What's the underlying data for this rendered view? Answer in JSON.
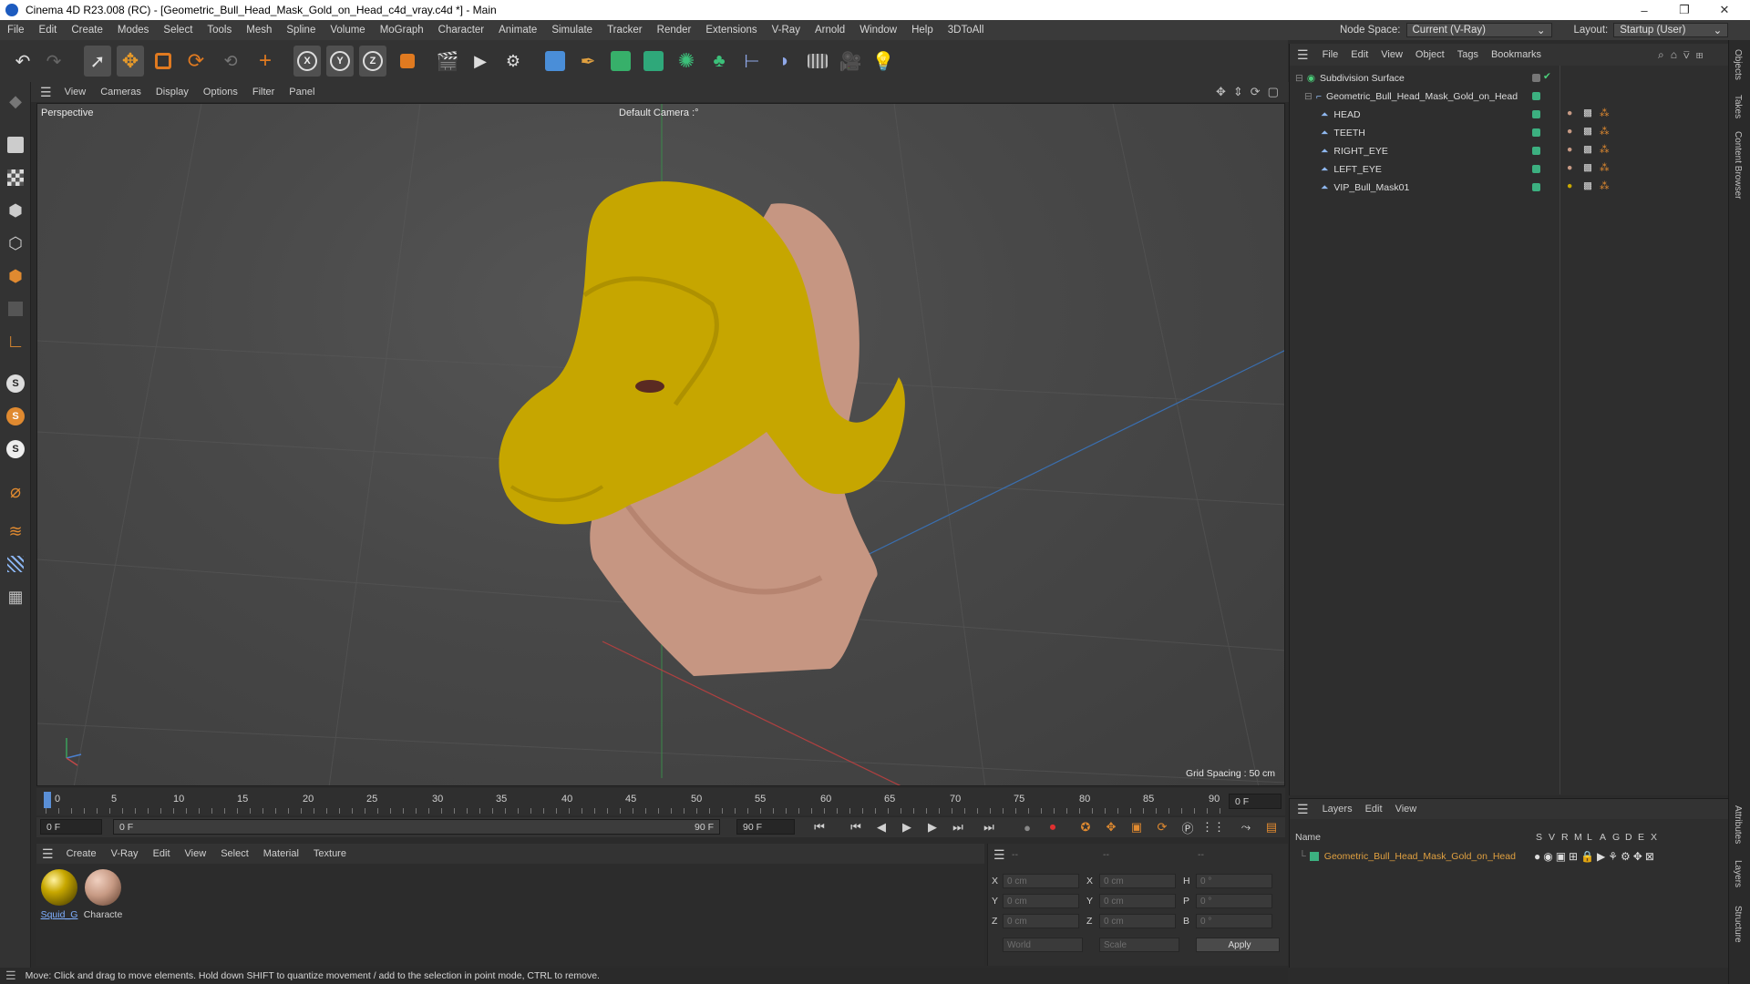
{
  "window": {
    "title": "Cinema 4D R23.008 (RC) - [Geometric_Bull_Head_Mask_Gold_on_Head_c4d_vray.c4d *] - Main",
    "minimize": "–",
    "maximize": "❐",
    "close": "✕"
  },
  "menubar": {
    "items": [
      "File",
      "Edit",
      "Create",
      "Modes",
      "Select",
      "Tools",
      "Mesh",
      "Spline",
      "Volume",
      "MoGraph",
      "Character",
      "Animate",
      "Simulate",
      "Tracker",
      "Render",
      "Extensions",
      "V-Ray",
      "Arnold",
      "Window",
      "Help",
      "3DToAll"
    ],
    "node_space_label": "Node Space:",
    "node_space_value": "Current (V-Ray)",
    "layout_label": "Layout:",
    "layout_value": "Startup (User)"
  },
  "viewport": {
    "menu": [
      "View",
      "Cameras",
      "Display",
      "Options",
      "Filter",
      "Panel"
    ],
    "view_name": "Perspective",
    "camera_name": "Default Camera",
    "grid_spacing": "Grid Spacing : 50 cm"
  },
  "timeline": {
    "ticks": [
      "0",
      "5",
      "10",
      "15",
      "20",
      "25",
      "30",
      "35",
      "40",
      "45",
      "50",
      "55",
      "60",
      "65",
      "70",
      "75",
      "80",
      "85",
      "90"
    ],
    "current_frame": "0 F",
    "start_field": "0 F",
    "range_start": "0 F",
    "range_end": "90 F",
    "end_field": "90 F"
  },
  "material_manager": {
    "menu": [
      "Create",
      "V-Ray",
      "Edit",
      "View",
      "Select",
      "Material",
      "Texture"
    ],
    "materials": [
      {
        "name": "Squid_G",
        "color": "#c8a800"
      },
      {
        "name": "Characte",
        "color": "#c79a84"
      }
    ]
  },
  "coordinates": {
    "header": [
      "--",
      "--",
      "--"
    ],
    "rows": [
      {
        "axis": "X",
        "pos": "0 cm",
        "axis2": "X",
        "size": "0 cm",
        "rot_label": "H",
        "rot": "0 °"
      },
      {
        "axis": "Y",
        "pos": "0 cm",
        "axis2": "Y",
        "size": "0 cm",
        "rot_label": "P",
        "rot": "0 °"
      },
      {
        "axis": "Z",
        "pos": "0 cm",
        "axis2": "Z",
        "size": "0 cm",
        "rot_label": "B",
        "rot": "0 °"
      }
    ],
    "mode_world": "World",
    "mode_scale": "Scale",
    "apply": "Apply"
  },
  "statusbar": {
    "text": "Move: Click and drag to move elements. Hold down SHIFT to quantize movement / add to the selection in point mode, CTRL to remove."
  },
  "objects": {
    "menu": [
      "File",
      "Edit",
      "View",
      "Object",
      "Tags",
      "Bookmarks"
    ],
    "tree": [
      {
        "name": "Subdivision Surface",
        "level": 0
      },
      {
        "name": "Geometric_Bull_Head_Mask_Gold_on_Head",
        "level": 1
      },
      {
        "name": "HEAD",
        "level": 2
      },
      {
        "name": "TEETH",
        "level": 2
      },
      {
        "name": "RIGHT_EYE",
        "level": 2
      },
      {
        "name": "LEFT_EYE",
        "level": 2
      },
      {
        "name": "VIP_Bull_Mask01",
        "level": 2
      }
    ]
  },
  "layers": {
    "menu": [
      "Layers",
      "Edit",
      "View"
    ],
    "name_header": "Name",
    "flags": [
      "S",
      "V",
      "R",
      "M",
      "L",
      "A",
      "G",
      "D",
      "E",
      "X"
    ],
    "rows": [
      {
        "name": "Geometric_Bull_Head_Mask_Gold_on_Head",
        "color": "#3cb080"
      }
    ]
  },
  "side_tabs": [
    "Objects",
    "Takes",
    "Content Browser",
    "Attributes",
    "Layers",
    "Structure"
  ],
  "colors": {
    "accent": "#5a8fd6",
    "gold": "#c8a400",
    "skin": "#c79a84",
    "layer_text": "#e0a040"
  }
}
